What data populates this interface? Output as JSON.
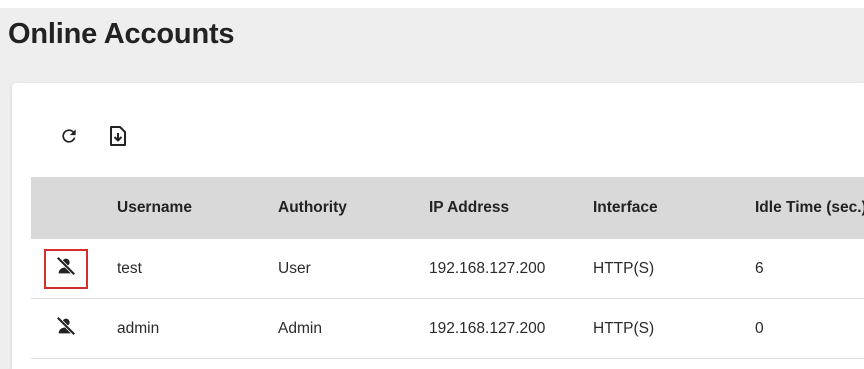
{
  "page": {
    "title": "Online Accounts"
  },
  "toolbar": {
    "refresh_icon": "refresh-icon",
    "export_icon": "file-download-icon"
  },
  "table": {
    "columns": [
      "",
      "Username",
      "Authority",
      "IP Address",
      "Interface",
      "Idle Time (sec.)"
    ],
    "rows": [
      {
        "action_icon": "person-off-icon",
        "highlighted": true,
        "username": "test",
        "authority": "User",
        "ip": "192.168.127.200",
        "interface": "HTTP(S)",
        "idle": "6"
      },
      {
        "action_icon": "person-off-icon",
        "highlighted": false,
        "username": "admin",
        "authority": "Admin",
        "ip": "192.168.127.200",
        "interface": "HTTP(S)",
        "idle": "0"
      }
    ]
  },
  "colors": {
    "header_bg": "#eeeeee",
    "table_header_bg": "#d9d9d9",
    "highlight": "#d32f2f"
  }
}
